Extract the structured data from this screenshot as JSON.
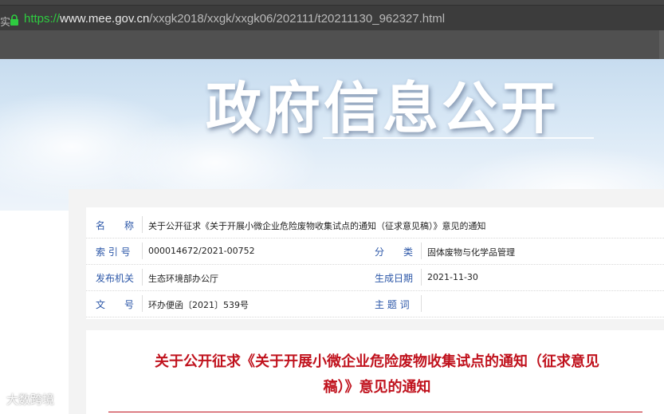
{
  "browser": {
    "tab_edge": "实",
    "url": {
      "scheme": "https://",
      "domain": "www.mee.gov.cn",
      "path": "/xxgk2018/xxgk/xxgk06/202111/t20211130_962327.html"
    },
    "secure_color": "#2ecc40"
  },
  "banner": {
    "title": "政府信息公开"
  },
  "meta": {
    "name_label": "名　　称",
    "name_value": "关于公开征求《关于开展小微企业危险废物收集试点的通知（征求意见稿）》意见的通知",
    "index_label": "索 引 号",
    "index_value": "000014672/2021-00752",
    "category_label": "分　　类",
    "category_value": "固体废物与化学品管理",
    "issuer_label": "发布机关",
    "issuer_value": "生态环境部办公厅",
    "date_label": "生成日期",
    "date_value": "2021-11-30",
    "docno_label": "文　　号",
    "docno_value": "环办便函〔2021〕539号",
    "subject_label": "主 题 词",
    "subject_value": ""
  },
  "article": {
    "title": "关于公开征求《关于开展小微企业危险废物收集试点的通知（征求意见稿）》意见的通知",
    "title_color": "#c0121d"
  },
  "watermark": {
    "text": "大数跨境"
  },
  "colors": {
    "label_blue": "#2c57a8",
    "browser_dark": "#3c3c3c"
  }
}
